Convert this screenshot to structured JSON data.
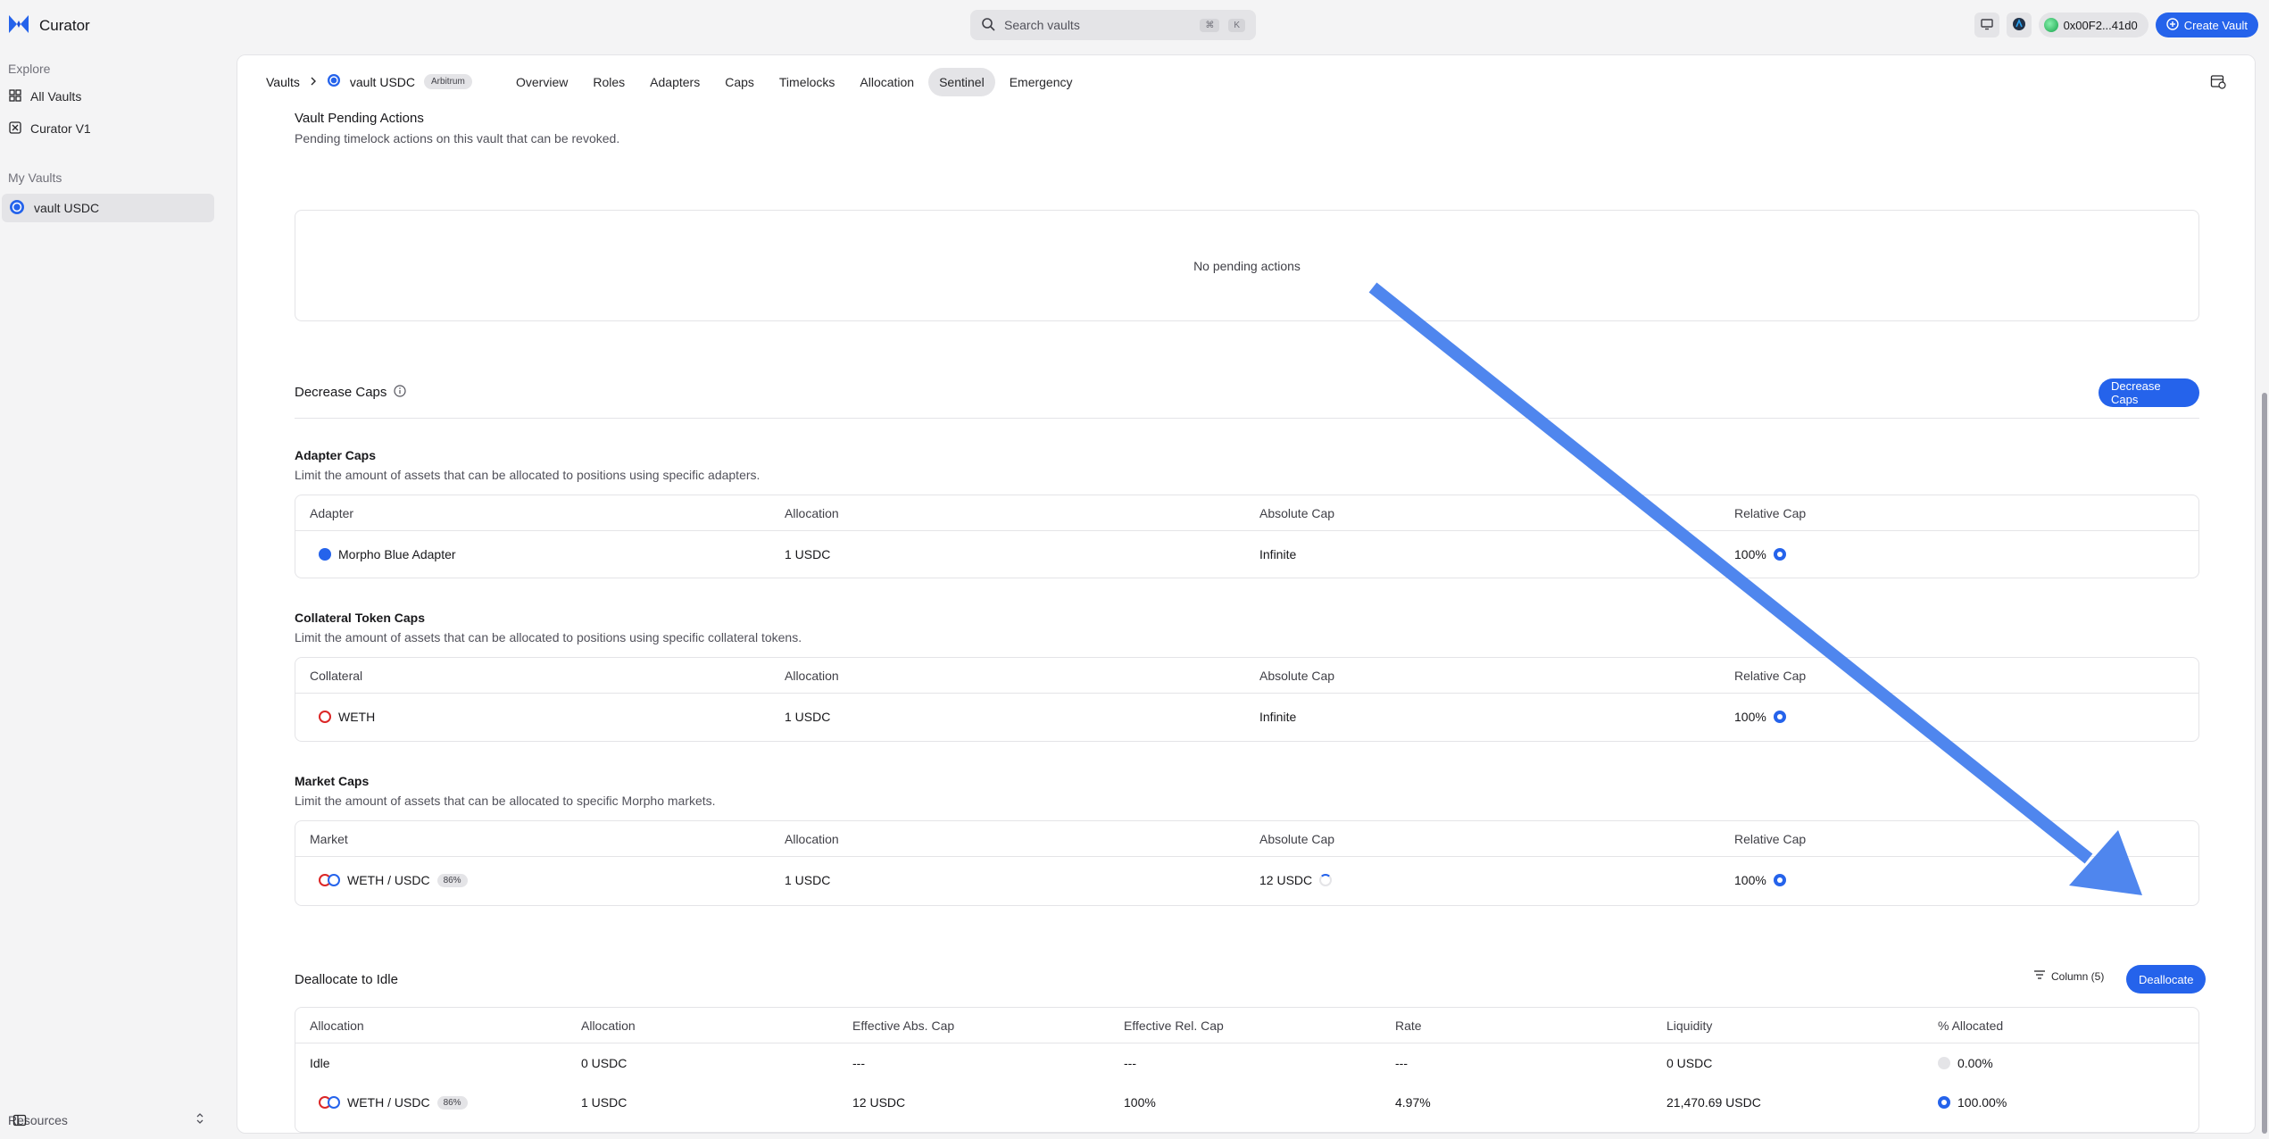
{
  "app": {
    "title": "Curator"
  },
  "search": {
    "placeholder": "Search vaults",
    "kbd1": "⌘",
    "kbd2": "K"
  },
  "header": {
    "wallet": "0x00F2...41d0",
    "create_vault": "Create Vault"
  },
  "sidebar": {
    "explore_heading": "Explore",
    "explore_items": [
      {
        "label": "All Vaults"
      },
      {
        "label": "Curator V1"
      }
    ],
    "my_vaults_heading": "My Vaults",
    "my_vaults_items": [
      {
        "label": "vault USDC"
      }
    ],
    "resources": "Resources"
  },
  "breadcrumb": {
    "root": "Vaults",
    "vault": "vault USDC",
    "network": "Arbitrum"
  },
  "tabs": [
    {
      "label": "Overview"
    },
    {
      "label": "Roles"
    },
    {
      "label": "Adapters"
    },
    {
      "label": "Caps"
    },
    {
      "label": "Timelocks"
    },
    {
      "label": "Allocation"
    },
    {
      "label": "Sentinel",
      "active": true
    },
    {
      "label": "Emergency"
    }
  ],
  "pending": {
    "title": "Vault Pending Actions",
    "description": "Pending timelock actions on this vault that can be revoked.",
    "empty": "No pending actions"
  },
  "decrease": {
    "title": "Decrease Caps",
    "button": "Decrease Caps"
  },
  "adapter_caps": {
    "title": "Adapter Caps",
    "description": "Limit the amount of assets that can be allocated to positions using specific adapters.",
    "headers": [
      "Adapter",
      "Allocation",
      "Absolute Cap",
      "Relative Cap"
    ],
    "row": {
      "name": "Morpho Blue Adapter",
      "allocation": "1 USDC",
      "absolute": "Infinite",
      "relative": "100%"
    }
  },
  "collateral_caps": {
    "title": "Collateral Token Caps",
    "description": "Limit the amount of assets that can be allocated to positions using specific collateral tokens.",
    "headers": [
      "Collateral",
      "Allocation",
      "Absolute Cap",
      "Relative Cap"
    ],
    "row": {
      "name": "WETH",
      "allocation": "1 USDC",
      "absolute": "Infinite",
      "relative": "100%"
    }
  },
  "market_caps": {
    "title": "Market Caps",
    "description": "Limit the amount of assets that can be allocated to specific Morpho markets.",
    "headers": [
      "Market",
      "Allocation",
      "Absolute Cap",
      "Relative Cap"
    ],
    "row": {
      "name": "WETH / USDC",
      "lltv": "86%",
      "allocation": "1 USDC",
      "absolute": "12 USDC",
      "relative": "100%"
    }
  },
  "deallocate": {
    "title": "Deallocate to Idle",
    "column_filter": "Column (5)",
    "button": "Deallocate",
    "headers": [
      "Allocation",
      "Allocation",
      "Effective Abs. Cap",
      "Effective Rel. Cap",
      "Rate",
      "Liquidity",
      "% Allocated"
    ],
    "rows": [
      {
        "name": "Idle",
        "allocation": "0 USDC",
        "abs": "---",
        "rel": "---",
        "rate": "---",
        "liquidity": "0 USDC",
        "pct": "0.00%"
      },
      {
        "name": "WETH / USDC",
        "lltv": "86%",
        "allocation": "1 USDC",
        "abs": "12 USDC",
        "rel": "100%",
        "rate": "4.97%",
        "liquidity": "21,470.69 USDC",
        "pct": "100.00%"
      }
    ]
  },
  "colors": {
    "accent": "#2563eb",
    "arrow": "#4f86ee"
  }
}
